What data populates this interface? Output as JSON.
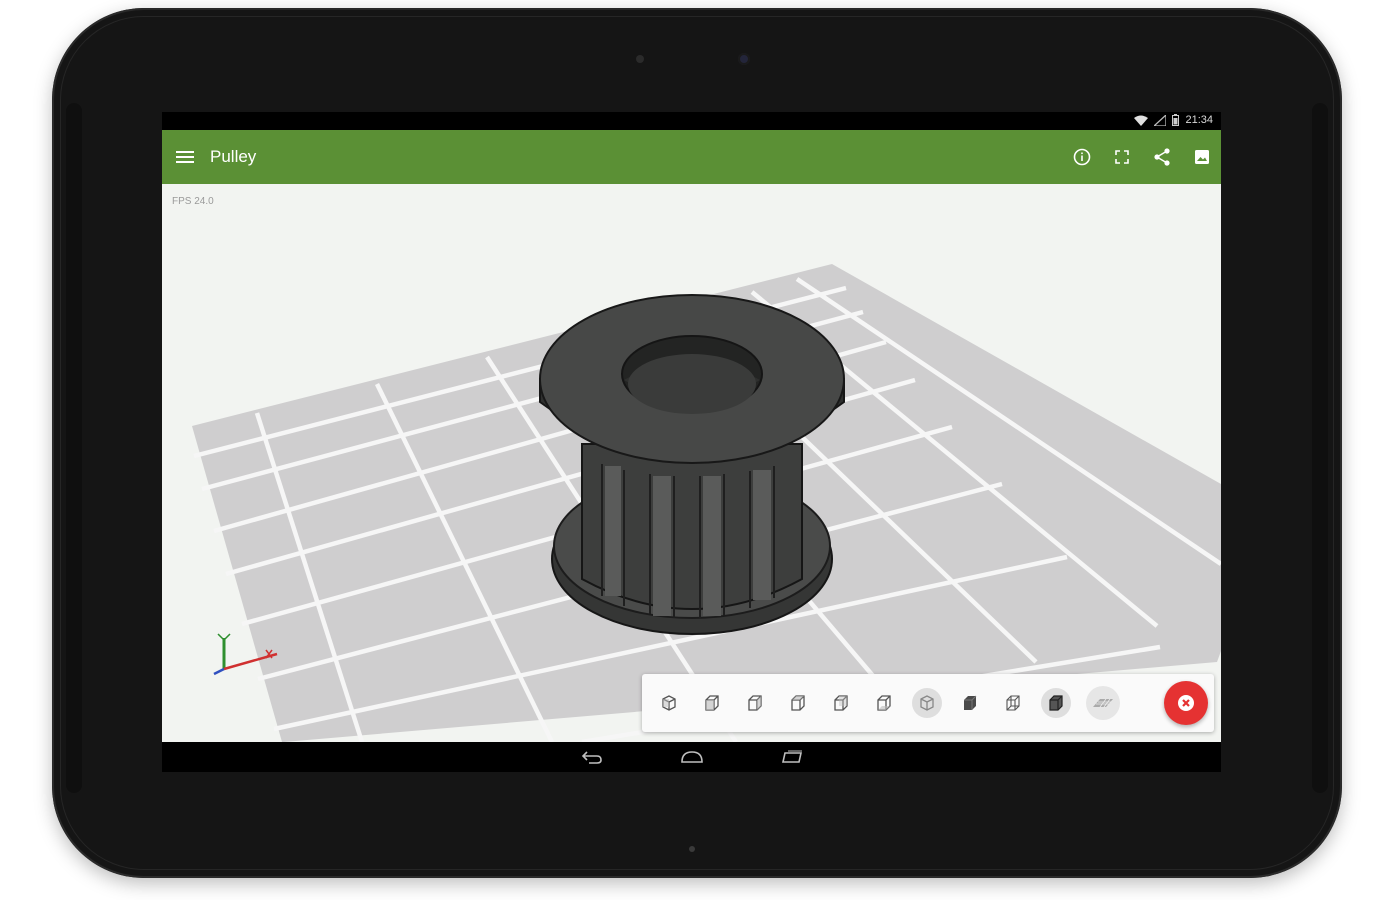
{
  "status_bar": {
    "time": "21:34",
    "icons": [
      "wifi-icon",
      "signal-icon",
      "battery-icon"
    ]
  },
  "app_bar": {
    "title": "Pulley",
    "color": "#5b9035",
    "menu_icon": "menu-icon",
    "actions": [
      "info-icon",
      "fullscreen-icon",
      "share-icon",
      "image-icon"
    ]
  },
  "viewport": {
    "fps_label": "FPS 24.0",
    "background": "#f2f4f1",
    "grid_color": "#cfcecf",
    "model_color": "#3e3f3e"
  },
  "toolbar": {
    "buttons": [
      "view-iso-icon",
      "view-front-icon",
      "view-back-icon",
      "view-left-icon",
      "view-right-icon",
      "view-top-icon",
      "view-bottom-icon",
      "shaded-icon",
      "wireframe-icon",
      "shaded-edges-icon",
      "grid-plane-icon"
    ],
    "active": "view-bottom-icon",
    "fab_icon": "close-icon",
    "fab_color": "#e53232"
  },
  "nav_bar": {
    "buttons": [
      "back-icon",
      "home-icon",
      "recents-icon"
    ]
  }
}
